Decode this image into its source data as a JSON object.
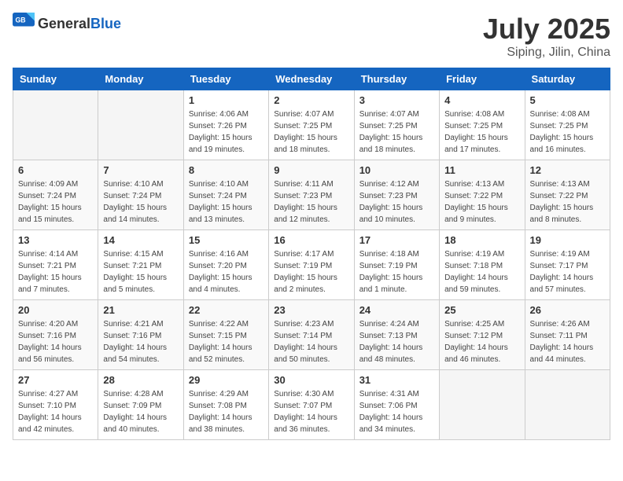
{
  "header": {
    "logo_general": "General",
    "logo_blue": "Blue",
    "title": "July 2025",
    "location": "Siping, Jilin, China"
  },
  "weekdays": [
    "Sunday",
    "Monday",
    "Tuesday",
    "Wednesday",
    "Thursday",
    "Friday",
    "Saturday"
  ],
  "weeks": [
    [
      {
        "day": "",
        "info": ""
      },
      {
        "day": "",
        "info": ""
      },
      {
        "day": "1",
        "info": "Sunrise: 4:06 AM\nSunset: 7:26 PM\nDaylight: 15 hours\nand 19 minutes."
      },
      {
        "day": "2",
        "info": "Sunrise: 4:07 AM\nSunset: 7:25 PM\nDaylight: 15 hours\nand 18 minutes."
      },
      {
        "day": "3",
        "info": "Sunrise: 4:07 AM\nSunset: 7:25 PM\nDaylight: 15 hours\nand 18 minutes."
      },
      {
        "day": "4",
        "info": "Sunrise: 4:08 AM\nSunset: 7:25 PM\nDaylight: 15 hours\nand 17 minutes."
      },
      {
        "day": "5",
        "info": "Sunrise: 4:08 AM\nSunset: 7:25 PM\nDaylight: 15 hours\nand 16 minutes."
      }
    ],
    [
      {
        "day": "6",
        "info": "Sunrise: 4:09 AM\nSunset: 7:24 PM\nDaylight: 15 hours\nand 15 minutes."
      },
      {
        "day": "7",
        "info": "Sunrise: 4:10 AM\nSunset: 7:24 PM\nDaylight: 15 hours\nand 14 minutes."
      },
      {
        "day": "8",
        "info": "Sunrise: 4:10 AM\nSunset: 7:24 PM\nDaylight: 15 hours\nand 13 minutes."
      },
      {
        "day": "9",
        "info": "Sunrise: 4:11 AM\nSunset: 7:23 PM\nDaylight: 15 hours\nand 12 minutes."
      },
      {
        "day": "10",
        "info": "Sunrise: 4:12 AM\nSunset: 7:23 PM\nDaylight: 15 hours\nand 10 minutes."
      },
      {
        "day": "11",
        "info": "Sunrise: 4:13 AM\nSunset: 7:22 PM\nDaylight: 15 hours\nand 9 minutes."
      },
      {
        "day": "12",
        "info": "Sunrise: 4:13 AM\nSunset: 7:22 PM\nDaylight: 15 hours\nand 8 minutes."
      }
    ],
    [
      {
        "day": "13",
        "info": "Sunrise: 4:14 AM\nSunset: 7:21 PM\nDaylight: 15 hours\nand 7 minutes."
      },
      {
        "day": "14",
        "info": "Sunrise: 4:15 AM\nSunset: 7:21 PM\nDaylight: 15 hours\nand 5 minutes."
      },
      {
        "day": "15",
        "info": "Sunrise: 4:16 AM\nSunset: 7:20 PM\nDaylight: 15 hours\nand 4 minutes."
      },
      {
        "day": "16",
        "info": "Sunrise: 4:17 AM\nSunset: 7:19 PM\nDaylight: 15 hours\nand 2 minutes."
      },
      {
        "day": "17",
        "info": "Sunrise: 4:18 AM\nSunset: 7:19 PM\nDaylight: 15 hours\nand 1 minute."
      },
      {
        "day": "18",
        "info": "Sunrise: 4:19 AM\nSunset: 7:18 PM\nDaylight: 14 hours\nand 59 minutes."
      },
      {
        "day": "19",
        "info": "Sunrise: 4:19 AM\nSunset: 7:17 PM\nDaylight: 14 hours\nand 57 minutes."
      }
    ],
    [
      {
        "day": "20",
        "info": "Sunrise: 4:20 AM\nSunset: 7:16 PM\nDaylight: 14 hours\nand 56 minutes."
      },
      {
        "day": "21",
        "info": "Sunrise: 4:21 AM\nSunset: 7:16 PM\nDaylight: 14 hours\nand 54 minutes."
      },
      {
        "day": "22",
        "info": "Sunrise: 4:22 AM\nSunset: 7:15 PM\nDaylight: 14 hours\nand 52 minutes."
      },
      {
        "day": "23",
        "info": "Sunrise: 4:23 AM\nSunset: 7:14 PM\nDaylight: 14 hours\nand 50 minutes."
      },
      {
        "day": "24",
        "info": "Sunrise: 4:24 AM\nSunset: 7:13 PM\nDaylight: 14 hours\nand 48 minutes."
      },
      {
        "day": "25",
        "info": "Sunrise: 4:25 AM\nSunset: 7:12 PM\nDaylight: 14 hours\nand 46 minutes."
      },
      {
        "day": "26",
        "info": "Sunrise: 4:26 AM\nSunset: 7:11 PM\nDaylight: 14 hours\nand 44 minutes."
      }
    ],
    [
      {
        "day": "27",
        "info": "Sunrise: 4:27 AM\nSunset: 7:10 PM\nDaylight: 14 hours\nand 42 minutes."
      },
      {
        "day": "28",
        "info": "Sunrise: 4:28 AM\nSunset: 7:09 PM\nDaylight: 14 hours\nand 40 minutes."
      },
      {
        "day": "29",
        "info": "Sunrise: 4:29 AM\nSunset: 7:08 PM\nDaylight: 14 hours\nand 38 minutes."
      },
      {
        "day": "30",
        "info": "Sunrise: 4:30 AM\nSunset: 7:07 PM\nDaylight: 14 hours\nand 36 minutes."
      },
      {
        "day": "31",
        "info": "Sunrise: 4:31 AM\nSunset: 7:06 PM\nDaylight: 14 hours\nand 34 minutes."
      },
      {
        "day": "",
        "info": ""
      },
      {
        "day": "",
        "info": ""
      }
    ]
  ]
}
